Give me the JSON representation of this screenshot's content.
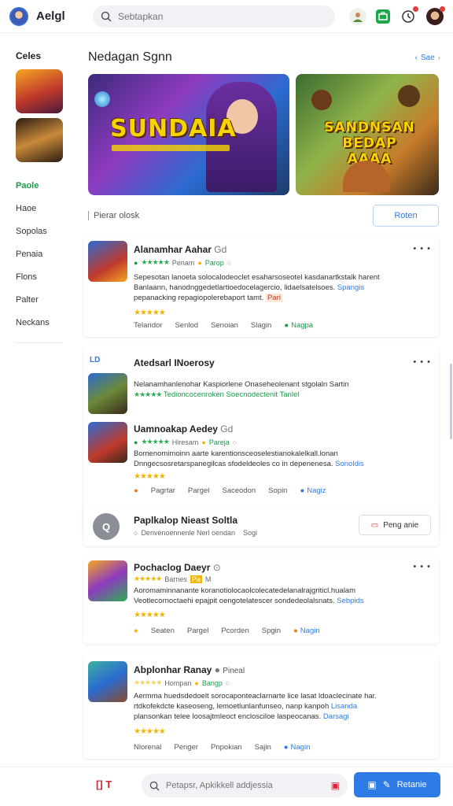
{
  "header": {
    "app_title": "Aelgl",
    "search_placeholder": "Sebtapkan"
  },
  "sidebar": {
    "heading": "Celes",
    "items": [
      "Paole",
      "Haoe",
      "Sopolas",
      "Penaia",
      "Flons",
      "Palter",
      "Neckans"
    ]
  },
  "main": {
    "section_title": "Nedagan Sgnn",
    "more_label": "Sae",
    "banner1_text": "SUNDAIA",
    "banner2_text": "SANDNSAN BEDAP AAAA",
    "filter_label": "Pierar olosk",
    "filter_button": "Roten"
  },
  "cards": [
    {
      "title": "Alanamhar Aahar",
      "title_badge": "Gd",
      "meta": [
        "Penam",
        "Parop"
      ],
      "desc_lines": [
        "Sepesotan lanoeta solocalodeoclet esaharsoseotel kasdanartkstalk harent",
        "Banlaann, hanodnggedetlartioedocelagercio, lidaelsatelsoes.",
        "pepanacking repagiopolerebaport tamt."
      ],
      "desc_link": "Spangis",
      "desc_badge": "Pari",
      "actions": [
        "Telandor",
        "Senlod",
        "Senoian",
        "Slagin",
        "Nagpa"
      ]
    },
    {
      "section_header": "Atedsarl INoerosy",
      "rows": [
        {
          "desc": "Nelanamhanlenohar Kaspiorlene Onaseheolenant stgolaln Sartin",
          "meta": "Tedioncocenroken Soecnodectenit Tanlel"
        },
        {
          "title": "Uamnoakap Aedey",
          "title_badge": "Gd",
          "meta": [
            "Hiresam",
            "Pareja"
          ],
          "desc_lines": [
            "Bomenomimoinn aarte karentionsceoselestianokalelkall.lonan",
            "Dnngecsosretarspanegilcas sfodeldeoles co in depenenesa."
          ],
          "desc_link": "Sonoldis",
          "actions": [
            "Pagrtar",
            "Pargel",
            "Saceodon",
            "Sopin",
            "Nagiz"
          ]
        }
      ]
    },
    {
      "title": "Paplkalop Nieast Soltla",
      "subtitle": "Denvenoennenle Nerl oendan",
      "subtitle_tail": "Sogi",
      "button": "Peng anie"
    },
    {
      "title": "Pochaclog Daeyr",
      "meta": [
        "Barnes",
        "Pa",
        "M"
      ],
      "desc_lines": [
        "Aoromaminnanante koranotiolocaolcolecatedelanalrajgriticl.hualam",
        "Veotlecornoctaehi epajpit oengotelatescer sondedeolalsnats."
      ],
      "desc_link": "Sebpids",
      "actions": [
        "Seaten",
        "Pargel",
        "Pcorden",
        "Spgin",
        "Nagin"
      ]
    },
    {
      "title": "Abplonhar Ranay",
      "title_badge": "Pineal",
      "meta": [
        "Hompan",
        "Bangp"
      ],
      "desc_lines": [
        "Aermma huedsdedoelt sorocaponteaclarnarte lice lasat ldoaclecinate har.",
        "rtdkofekdcte kaseoseng, lemoetlunlanfunseo, nanp kanpoh",
        "plansonkan telee loosajtmleoct enclosciloe laspeocanas."
      ],
      "desc_links": [
        "Lisanda",
        "Darsagi"
      ],
      "actions": [
        "Nlorenal",
        "Penger",
        "Pnpokian",
        "Sajin",
        "Nagin"
      ]
    }
  ],
  "bottom": {
    "left_label": "[] T",
    "search_placeholder": "Petapsr, Apkikkell addjessia",
    "primary_button": "Retanie"
  },
  "colors": {
    "accent_blue": "#2f7be5",
    "accent_green": "#1a9b4b",
    "star_gold": "#f4b400"
  }
}
